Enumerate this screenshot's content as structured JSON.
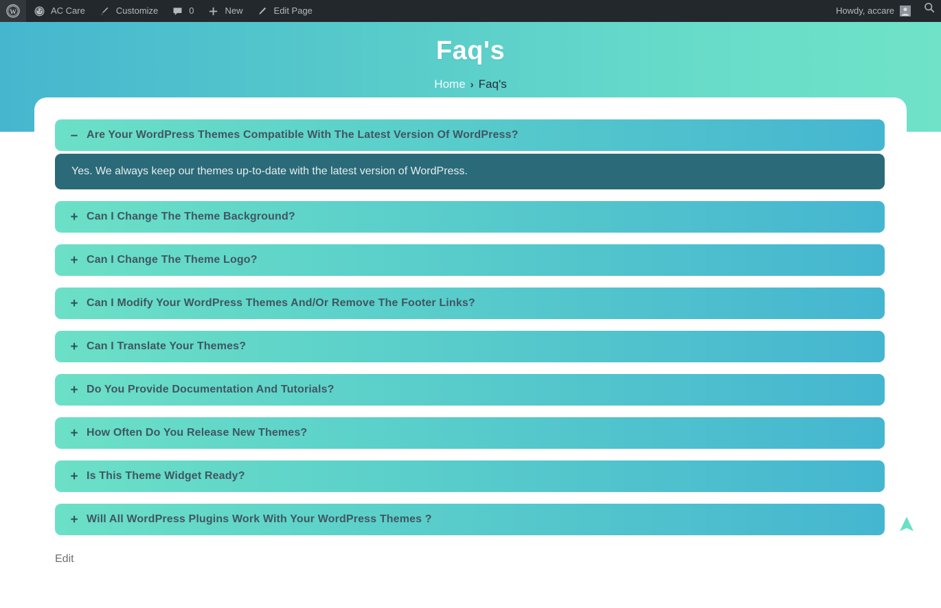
{
  "adminbar": {
    "wp_logo_label": "",
    "items": [
      {
        "icon": "wordpress-logo-icon",
        "label": ""
      },
      {
        "icon": "dashboard-icon",
        "label": "AC Care"
      },
      {
        "icon": "paintbrush-icon",
        "label": "Customize"
      },
      {
        "icon": "comment-bubble-icon",
        "label": "0"
      },
      {
        "icon": "plus-icon",
        "label": "New"
      },
      {
        "icon": "pencil-icon",
        "label": "Edit Page"
      }
    ],
    "howdy": "Howdy, accare",
    "search_label": "Search",
    "background": "#23282d",
    "text_color": "#b4b9be"
  },
  "hero": {
    "title": "Faq's",
    "gradient_from": "#46b6cf",
    "gradient_to": "#6fe2c8",
    "breadcrumb": {
      "home": "Home",
      "separator": "›",
      "current": "Faq's"
    }
  },
  "accordion": {
    "header_gradient_from": "#6ce0c6",
    "header_gradient_to": "#45b6d0",
    "panel_color": "#2b6a78",
    "question_color": "#3f5663",
    "expand_sign": "+",
    "collapse_sign": "–",
    "items": [
      {
        "question": "Are Your WordPress Themes Compatible With The Latest Version Of WordPress?",
        "answer": "Yes. We always keep our themes up-to-date with the latest version of WordPress.",
        "open": true
      },
      {
        "question": "Can I Change The Theme Background?",
        "answer": "",
        "open": false
      },
      {
        "question": "Can I Change The Theme Logo?",
        "answer": "",
        "open": false
      },
      {
        "question": "Can I Modify Your WordPress Themes And/Or Remove The Footer Links?",
        "answer": "",
        "open": false
      },
      {
        "question": "Can I Translate Your Themes?",
        "answer": "",
        "open": false
      },
      {
        "question": "Do You Provide Documentation And Tutorials?",
        "answer": "",
        "open": false
      },
      {
        "question": "How Often Do You Release New Themes?",
        "answer": "",
        "open": false
      },
      {
        "question": "Is This Theme Widget Ready?",
        "answer": "",
        "open": false
      },
      {
        "question": "Will All WordPress Plugins Work With Your WordPress Themes ?",
        "answer": "",
        "open": false
      }
    ]
  },
  "footer": {
    "edit_label": "Edit"
  },
  "scroll_top": {
    "icon": "arrow-up-icon",
    "color": "#6ae0c5"
  }
}
